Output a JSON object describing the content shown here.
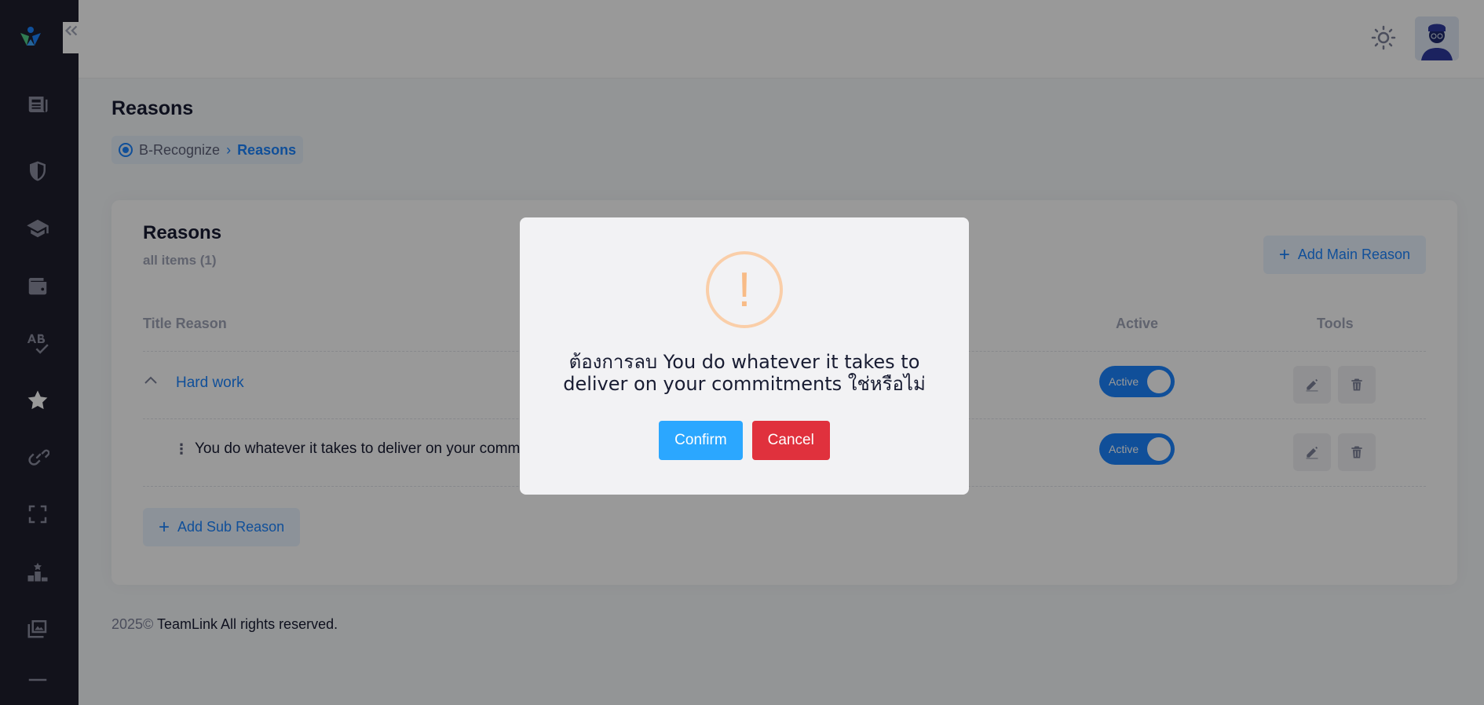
{
  "sidebar": {
    "logo": "teamlink-logo-icon",
    "collapse_icon": "double-chevron-left-icon",
    "items": [
      {
        "name": "sidebar-item-news",
        "icon": "newspaper-icon"
      },
      {
        "name": "sidebar-item-security",
        "icon": "shield-icon"
      },
      {
        "name": "sidebar-item-education",
        "icon": "graduation-cap-icon"
      },
      {
        "name": "sidebar-item-wallet",
        "icon": "wallet-icon"
      },
      {
        "name": "sidebar-item-spellcheck",
        "icon": "spellcheck-icon"
      },
      {
        "name": "sidebar-item-recognize",
        "icon": "star-icon",
        "active": true
      },
      {
        "name": "sidebar-item-links",
        "icon": "link-icon"
      },
      {
        "name": "sidebar-item-fullscreen",
        "icon": "fullscreen-icon"
      },
      {
        "name": "sidebar-item-leaderboard",
        "icon": "podium-icon"
      },
      {
        "name": "sidebar-item-gallery",
        "icon": "images-icon"
      },
      {
        "name": "sidebar-item-more",
        "icon": "minus-icon"
      }
    ]
  },
  "header": {
    "theme_icon": "sun-icon",
    "avatar_icon": "user-avatar-icon"
  },
  "page": {
    "title": "Reasons",
    "breadcrumb": {
      "root": "B-Recognize",
      "current": "Reasons"
    }
  },
  "card": {
    "title": "Reasons",
    "subtitle": "all items (1)",
    "add_main_label": "Add Main Reason",
    "columns": {
      "title": "Title Reason",
      "active": "Active",
      "tools": "Tools"
    },
    "main_reason": {
      "label": "Hard work",
      "status": "Active"
    },
    "sub_reason": {
      "label": "You do whatever it takes to deliver on your commit",
      "status": "Active"
    },
    "add_sub_label": "Add Sub Reason"
  },
  "footer": {
    "year": "2025©",
    "text": "TeamLink All rights reserved."
  },
  "modal": {
    "icon": "!",
    "message": "ต้องการลบ You do whatever it takes to deliver on your commitments ใช่หรือไม่",
    "confirm_label": "Confirm",
    "cancel_label": "Cancel"
  },
  "colors": {
    "primary": "#1b84ff",
    "confirm": "#2ba7ff",
    "cancel": "#e0313d",
    "warning": "#f8bb86",
    "sidebar": "#1e1e2d"
  }
}
